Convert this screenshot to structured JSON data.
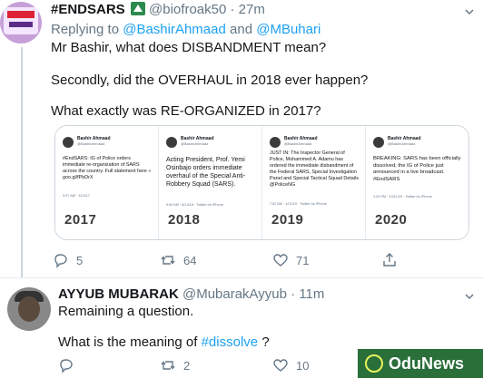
{
  "tweet1": {
    "name": "#ENDSARS",
    "handle": "@biofroak50",
    "time": "· 27m",
    "reply_prefix": "Replying to",
    "reply_to_1": "@BashirAhmaad",
    "reply_and": "and",
    "reply_to_2": "@MBuhari",
    "lines": [
      "Mr Bashir, what does DISBANDMENT mean?",
      "Secondly, did the OVERHAUL in 2018 ever happen?",
      "What exactly was RE-ORGANIZED in 2017?"
    ],
    "cards": [
      {
        "author": "Bashir Ahmaad",
        "handle": "@BashirAhmaad",
        "body": "#EndSARS: IG of Police orders immediate re-organization of SARS across the country. Full statement here » goo.gl/fPbDrX",
        "meta": "9:37 AM · 12/4/17",
        "year": "2017"
      },
      {
        "author": "Bashir Ahmaad",
        "handle": "@BashirAhmaad",
        "body": "Acting President, Prof. Yemi Osinbajo orders immediate overhaul of the Special Anti-Robbery Squad (SARS).",
        "meta": "9:59 AM · 8/14/18 · Twitter for iPhone",
        "year": "2018"
      },
      {
        "author": "Bashir Ahmaad",
        "handle": "@BashirAhmaad",
        "body": "JUST IN: The Inspector General of Police, Mohammed A. Adamu has ordered the immediate disbandment of the Federal SARS, Special Investigation Panel and Special Tactical Squad Details @PoliceNG",
        "meta": "7:52 AM · 1/21/19 · Twitter for iPhone",
        "year": "2019"
      },
      {
        "author": "Bashir Ahmaad",
        "handle": "@BashirAhmaad",
        "body": "BREAKING: SARS has been officially dissolved, the IG of Police just announced in a live broadcast. #EndSARS",
        "meta": "1:20 PM · 10/11/20 · Twitter for iPhone",
        "year": "2020"
      }
    ],
    "actions": {
      "replies": "5",
      "retweets": "64",
      "likes": "71"
    }
  },
  "tweet2": {
    "name": "AYYUB MUBARAK",
    "handle": "@MubarakAyyub",
    "time": "· 11m",
    "line1": "Remaining a question.",
    "line2_pre": "What is the meaning of",
    "line2_tag": "#dissolve",
    "line2_post": "?",
    "actions": {
      "retweets": "2",
      "likes": "10"
    }
  },
  "watermark": "OduNews",
  "colors": {
    "link": "#1da1f2",
    "muted": "#657786",
    "retweet_green": "#17bf63",
    "watermark_green": "#2a6e3a"
  }
}
